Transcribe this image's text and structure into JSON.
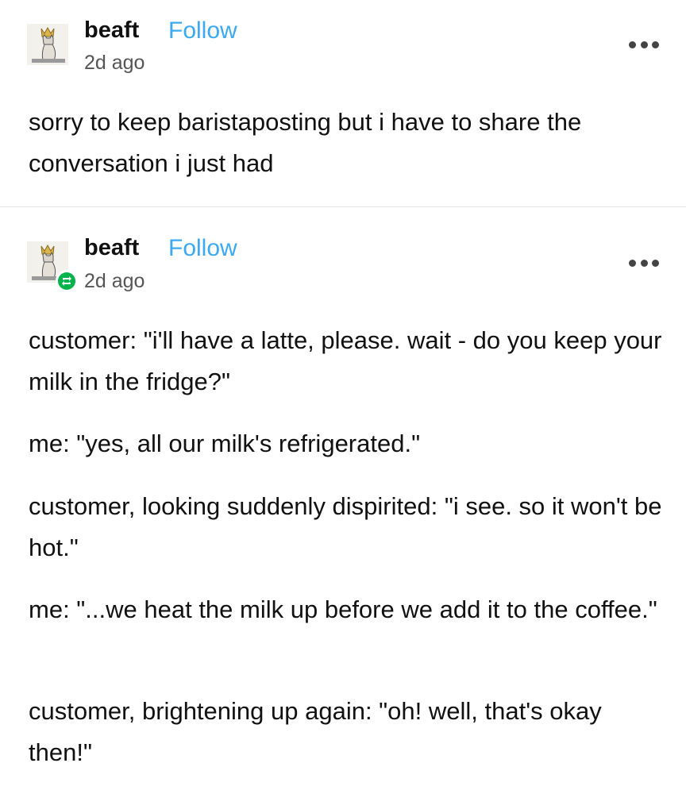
{
  "posts": [
    {
      "username": "beaft",
      "follow_label": "Follow",
      "timestamp": "2d ago",
      "is_reblog": false,
      "paragraphs": [
        "sorry to keep baristaposting but i have to share the conversation i just had"
      ]
    },
    {
      "username": "beaft",
      "follow_label": "Follow",
      "timestamp": "2d ago",
      "is_reblog": true,
      "paragraphs": [
        "customer: \"i'll have a latte, please. wait - do you keep your milk in the fridge?\"",
        "me: \"yes, all our milk's refrigerated.\"",
        "customer, looking suddenly dispirited: \"i see. so it won't be hot.\"",
        "me: \"...we heat the milk up before we add it to the coffee.\"",
        "customer, brightening up again: \"oh! well, that's okay then!\""
      ]
    }
  ],
  "icons": {
    "avatar": "cat-with-crown-avatar",
    "reblog": "reblog-icon",
    "more": "more-options-icon"
  },
  "colors": {
    "follow": "#3aa9f2",
    "reblog_badge": "#00b34a",
    "text": "#111111",
    "timestamp": "#555555",
    "divider": "#e3e3e3"
  }
}
